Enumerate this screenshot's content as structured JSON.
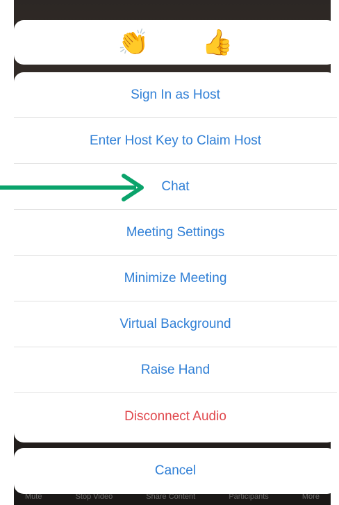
{
  "reactions": [
    {
      "icon": "clapping-hands-icon",
      "glyph": "👏"
    },
    {
      "icon": "thumbs-up-icon",
      "glyph": "👍"
    }
  ],
  "menu": {
    "items": [
      {
        "label": "Sign In as Host"
      },
      {
        "label": "Enter Host Key to Claim Host"
      },
      {
        "label": "Chat"
      },
      {
        "label": "Meeting Settings"
      },
      {
        "label": "Minimize Meeting"
      },
      {
        "label": "Virtual Background"
      },
      {
        "label": "Raise Hand"
      },
      {
        "label": "Disconnect Audio"
      }
    ]
  },
  "cancel_label": "Cancel",
  "toolbar": {
    "items": [
      "Mute",
      "Stop Video",
      "Share Content",
      "Participants",
      "More"
    ]
  },
  "colors": {
    "action_blue": "#2f7fd6",
    "destructive_red": "#e0474c",
    "annotation_arrow": "#0aa36b"
  }
}
